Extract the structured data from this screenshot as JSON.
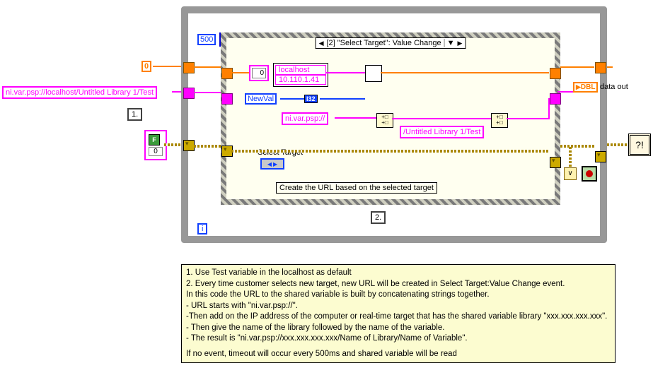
{
  "loop": {
    "timeout_ms": "500",
    "iter_glyph": "i"
  },
  "event": {
    "title": "[2] \"Select Target\": Value Change"
  },
  "inputs": {
    "zero_const": "0",
    "url_const": "ni.var.psp://localhost/Untitled Library 1/Test",
    "callout_1": "1.",
    "callout_2": "2."
  },
  "targets": {
    "index": "0",
    "items": [
      "localhost",
      "10.110.1.41"
    ]
  },
  "newval_label": "NewVal",
  "i32_label": "I32",
  "protocol_const": "ni.var.psp://",
  "path_const": "/Untitled Library 1/Test",
  "select_target_label": "Select Target",
  "comment": "Create the URL based on the selected target",
  "data_out_label": "data out",
  "dbl_label": "DBL",
  "cluster": {
    "false": "F",
    "zero": "0"
  },
  "notes": {
    "l1": "1. Use Test variable in the localhost as default",
    "l2": "2. Every time customer selects new target, new URL will be created in Select Target:Value Change event.",
    "l3": "In this code the URL to the shared variable is built by concatenating strings together.",
    "l4": " - URL starts with \"ni.var.psp://\".",
    "l5": " -Then add on the IP address of the computer or real-time target that has the shared variable library \"xxx.xxx.xxx.xxx\".",
    "l6": " - Then  give the name of the library followed by the name of the variable.",
    "l7": " - The result is \"ni.var.psp://xxx.xxx.xxx.xxx/Name of Library/Name of Variable\".",
    "l8": "If no event, timeout will occur every 500ms and shared variable will be read"
  }
}
